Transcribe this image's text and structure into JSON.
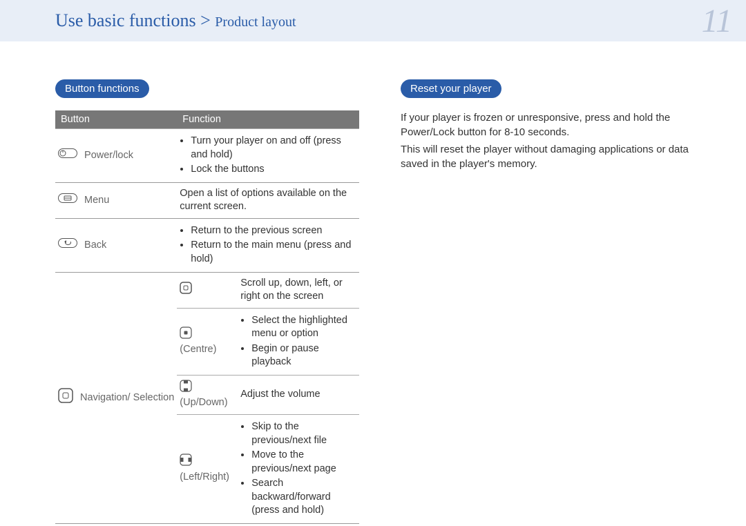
{
  "header": {
    "breadcrumb_main": "Use basic functions",
    "breadcrumb_sep": " > ",
    "breadcrumb_sub": "Product layout",
    "page_number": "11"
  },
  "left": {
    "heading": "Button functions",
    "table": {
      "head_button": "Button",
      "head_function": "Function",
      "rows": [
        {
          "button": "Power/lock",
          "functions": [
            "Turn your player on and off (press and hold)",
            "Lock the buttons"
          ]
        },
        {
          "button": "Menu",
          "function_text": "Open a list of options available on the current screen."
        },
        {
          "button": "Back",
          "functions": [
            "Return to the previous screen",
            "Return to the main menu (press and hold)"
          ]
        },
        {
          "button": "Navigation/ Selection",
          "sub": [
            {
              "label": "",
              "text": "Scroll up, down, left, or right on the screen"
            },
            {
              "label": "(Centre)",
              "functions": [
                "Select the highlighted menu or option",
                "Begin or pause playback"
              ]
            },
            {
              "label": "(Up/Down)",
              "text": "Adjust the volume"
            },
            {
              "label": "(Left/Right)",
              "functions": [
                "Skip to the previous/next file",
                "Move to the previous/next page",
                "Search backward/forward (press and hold)"
              ]
            }
          ]
        }
      ]
    }
  },
  "right": {
    "heading": "Reset your player",
    "para1": "If your player is frozen or unresponsive, press and hold the Power/Lock button for 8-10 seconds.",
    "para2": "This will reset the player without damaging applications or data saved in the player's memory."
  }
}
